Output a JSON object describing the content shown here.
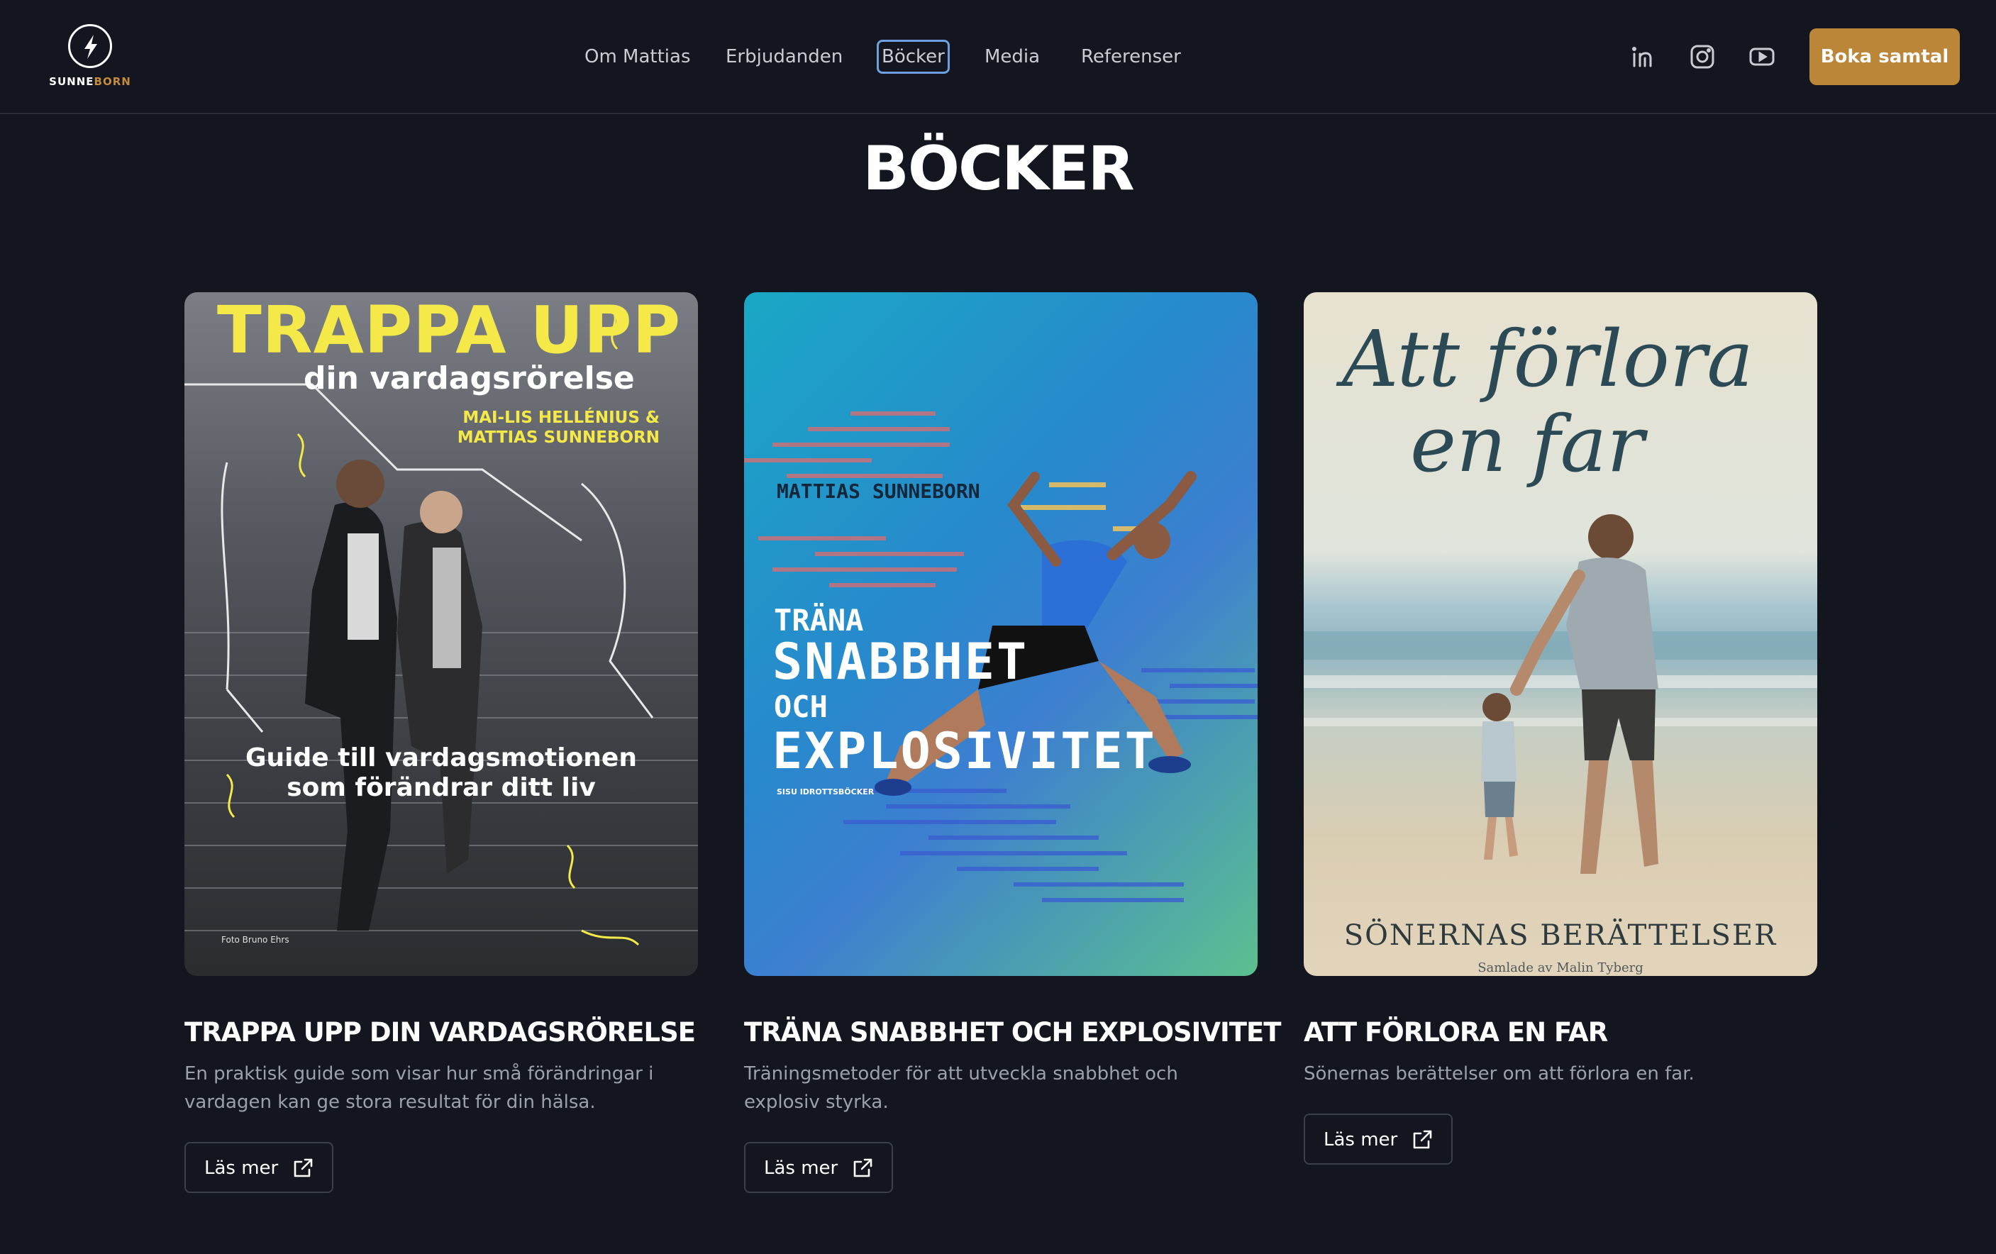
{
  "logo": {
    "text_part1": "SUNNE",
    "text_part2": "BORN"
  },
  "nav": {
    "items": [
      {
        "label": "Om Mattias"
      },
      {
        "label": "Erbjudanden"
      },
      {
        "label": "Böcker"
      },
      {
        "label": "Media"
      },
      {
        "label": "Referenser"
      }
    ],
    "active": "Böcker"
  },
  "social": [
    "linkedin-icon",
    "instagram-icon",
    "youtube-icon"
  ],
  "cta": {
    "label": "Boka samtal"
  },
  "page": {
    "title": "BÖCKER"
  },
  "books": [
    {
      "title": "TRAPPA UPP DIN VARDAGSRÖRELSE",
      "description": "En praktisk guide som visar hur små förändringar i vardagen kan ge stora resultat för din hälsa.",
      "button": "Läs mer",
      "cover": {
        "line1": "TRAPPA UPP",
        "line2": "din vardagsrörelse",
        "author1": "MAI-LIS HELLÉNIUS &",
        "author2": "MATTIAS SUNNEBORN",
        "guide1": "Guide till vardagsmotionen",
        "guide2": "som förändrar ditt liv",
        "photo_credit": "Foto Bruno Ehrs"
      }
    },
    {
      "title": "TRÄNA SNABBHET OCH EXPLOSIVITET",
      "description": "Träningsmetoder för att utveckla snabbhet och explosiv styrka.",
      "button": "Läs mer",
      "cover": {
        "author": "MATTIAS SUNNEBORN",
        "line1": "TRÄNA",
        "line2": "SNABBHET",
        "line3": "OCH",
        "line4": "EXPLOSIVITET",
        "publisher": "SISU IDROTTSBÖCKER"
      }
    },
    {
      "title": "ATT FÖRLORA EN FAR",
      "description": "Sönernas berättelser om att förlora en far.",
      "button": "Läs mer",
      "cover": {
        "line1": "Att förlora",
        "line2": "en far",
        "subtitle": "SÖNERNAS BERÄTTELSER",
        "editor": "Samlade av Malin Tyberg"
      }
    }
  ],
  "colors": {
    "background": "#13161f",
    "accent": "#bb8638",
    "text_muted": "#9ca0aa"
  }
}
